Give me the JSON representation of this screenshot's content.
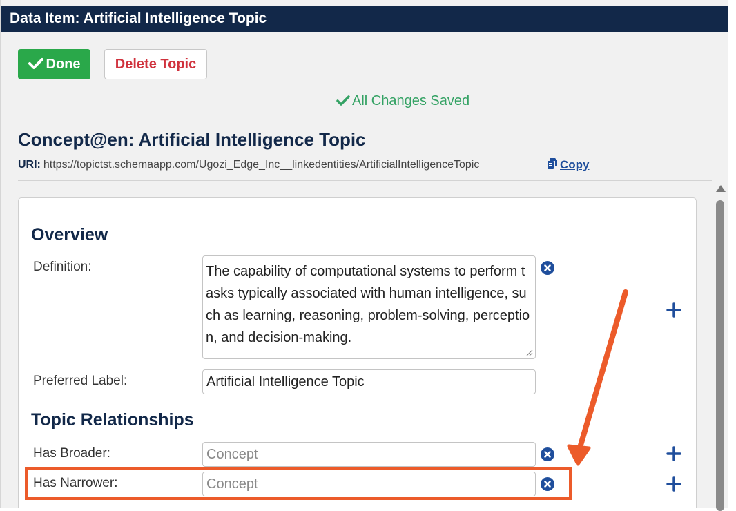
{
  "header": {
    "title": "Data Item: Artificial Intelligence Topic"
  },
  "toolbar": {
    "done_label": "Done",
    "delete_label": "Delete Topic"
  },
  "status": {
    "saved_text": "All Changes Saved"
  },
  "concept": {
    "title": "Concept@en: Artificial Intelligence Topic",
    "uri_label": "URI:",
    "uri": "https://topictst.schemaapp.com/Ugozi_Edge_Inc__linkedentities/ArtificialIntelligenceTopic",
    "copy_label": "Copy"
  },
  "overview": {
    "heading": "Overview",
    "definition_label": "Definition:",
    "definition_value": "The capability of computational systems to perform tasks typically associated with human intelligence, such as learning, reasoning, problem-solving, perception, and decision-making.",
    "preferred_label_label": "Preferred Label:",
    "preferred_label_value": "Artificial Intelligence Topic"
  },
  "relationships": {
    "heading": "Topic Relationships",
    "broader_label": "Has Broader:",
    "broader_placeholder": "Concept",
    "narrower_label": "Has Narrower:",
    "narrower_placeholder": "Concept"
  },
  "icons": {
    "done": "check-icon",
    "saved": "check-icon",
    "copy": "copy-icon",
    "remove": "close-circle-icon",
    "add": "plus-icon"
  },
  "colors": {
    "header_bg": "#122849",
    "done_bg": "#2aa84a",
    "delete_text": "#d0323d",
    "saved_text": "#34a264",
    "link": "#1f4e9c",
    "annotation": "#ec5b2a"
  }
}
